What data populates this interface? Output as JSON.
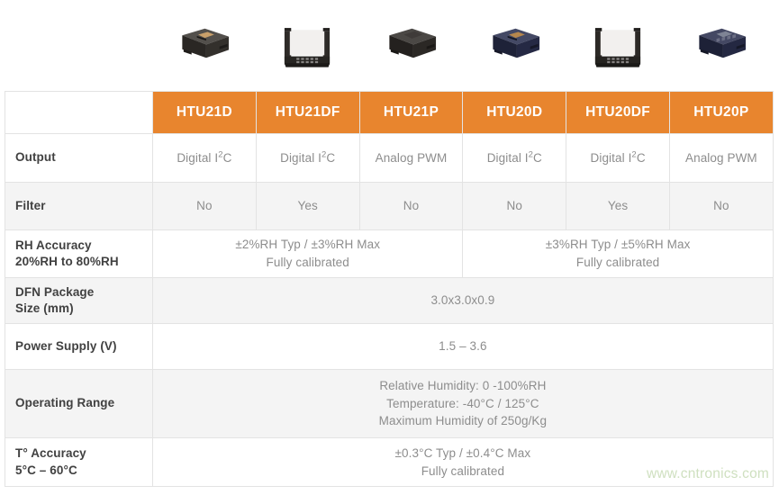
{
  "products": [
    {
      "name": "HTU21D",
      "icon": "chip-black-top-view",
      "body_color": "#3c3834",
      "pad_color": "#c9a06a",
      "style": "flat-black"
    },
    {
      "name": "HTU21DF",
      "icon": "chip-black-filter-cap",
      "body_color": "#2e2b28",
      "pad_color": "#ffffff",
      "style": "filter-cap-black"
    },
    {
      "name": "HTU21P",
      "icon": "chip-black-plain-top",
      "body_color": "#332f2c",
      "pad_color": "#2a2724",
      "style": "flat-black-plain"
    },
    {
      "name": "HTU20D",
      "icon": "chip-blue-top-view",
      "body_color": "#2b3050",
      "pad_color": "#b6874d",
      "style": "flat-blue"
    },
    {
      "name": "HTU20DF",
      "icon": "chip-black-filter-cap-2",
      "body_color": "#2c2926",
      "pad_color": "#ffffff",
      "style": "filter-cap-black"
    },
    {
      "name": "HTU20P",
      "icon": "chip-blue-plain-top",
      "body_color": "#2a2f4e",
      "pad_color": "#8a8f9e",
      "style": "flat-blue-plain"
    }
  ],
  "table": {
    "corner_label": "",
    "columns": [
      "HTU21D",
      "HTU21DF",
      "HTU21P",
      "HTU20D",
      "HTU20DF",
      "HTU20P"
    ],
    "rows": [
      {
        "label": "Output",
        "label_lines": [
          "Output"
        ],
        "shaded": false,
        "cells": [
          {
            "text": "Digital I2C",
            "base": "Digital I",
            "sup": "2",
            "tail": "C",
            "span": 1
          },
          {
            "text": "Digital I2C",
            "base": "Digital I",
            "sup": "2",
            "tail": "C",
            "span": 1
          },
          {
            "text": "Analog PWM",
            "base": "Analog PWM",
            "sup": "",
            "tail": "",
            "span": 1
          },
          {
            "text": "Digital I2C",
            "base": "Digital I",
            "sup": "2",
            "tail": "C",
            "span": 1
          },
          {
            "text": "Digital I2C",
            "base": "Digital I",
            "sup": "2",
            "tail": "C",
            "span": 1
          },
          {
            "text": "Analog PWM",
            "base": "Analog PWM",
            "sup": "",
            "tail": "",
            "span": 1
          }
        ]
      },
      {
        "label": "Filter",
        "label_lines": [
          "Filter"
        ],
        "shaded": true,
        "cells": [
          {
            "text": "No",
            "base": "No",
            "sup": "",
            "tail": "",
            "span": 1
          },
          {
            "text": "Yes",
            "base": "Yes",
            "sup": "",
            "tail": "",
            "span": 1
          },
          {
            "text": "No",
            "base": "No",
            "sup": "",
            "tail": "",
            "span": 1
          },
          {
            "text": "No",
            "base": "No",
            "sup": "",
            "tail": "",
            "span": 1
          },
          {
            "text": "Yes",
            "base": "Yes",
            "sup": "",
            "tail": "",
            "span": 1
          },
          {
            "text": "No",
            "base": "No",
            "sup": "",
            "tail": "",
            "span": 1
          }
        ]
      },
      {
        "label": "RH Accuracy 20%RH to 80%RH",
        "label_lines": [
          "RH Accuracy",
          "20%RH to 80%RH"
        ],
        "shaded": false,
        "cells": [
          {
            "text": "±2%RH Typ / ±3%RH Max Fully calibrated",
            "lines": [
              "±2%RH Typ / ±3%RH Max",
              "Fully calibrated"
            ],
            "span": 3
          },
          {
            "text": "±3%RH Typ / ±5%RH Max Fully calibrated",
            "lines": [
              "±3%RH Typ / ±5%RH Max",
              "Fully calibrated"
            ],
            "span": 3
          }
        ]
      },
      {
        "label": "DFN Package Size (mm)",
        "label_lines": [
          "DFN Package",
          "Size (mm)"
        ],
        "shaded": true,
        "cells": [
          {
            "text": "3.0x3.0x0.9",
            "lines": [
              "3.0x3.0x0.9"
            ],
            "span": 6
          }
        ]
      },
      {
        "label": "Power Supply (V)",
        "label_lines": [
          "Power Supply (V)"
        ],
        "shaded": false,
        "cells": [
          {
            "text": "1.5 – 3.6",
            "lines": [
              "1.5 – 3.6"
            ],
            "span": 6
          }
        ]
      },
      {
        "label": "Operating Range",
        "label_lines": [
          "Operating Range"
        ],
        "shaded": true,
        "cells": [
          {
            "text": "Relative Humidity: 0 -100%RH Temperature: -40°C / 125°C Maximum Humidity of 250g/Kg",
            "lines": [
              "Relative Humidity: 0 -100%RH",
              "Temperature: -40°C / 125°C",
              "Maximum Humidity of 250g/Kg"
            ],
            "span": 6
          }
        ]
      },
      {
        "label": "T° Accuracy 5°C – 60°C",
        "label_lines": [
          "T° Accuracy",
          "5°C – 60°C"
        ],
        "shaded": false,
        "cells": [
          {
            "text": "±0.3°C Typ / ±0.4°C Max Fully calibrated",
            "lines": [
              "±0.3°C Typ / ±0.4°C Max",
              "Fully calibrated"
            ],
            "span": 6
          }
        ]
      }
    ]
  },
  "watermark": {
    "text": "www.cntronics.com",
    "color": "#cfe0c0"
  },
  "colors": {
    "header_orange": "#e8852e",
    "header_divider": "#ef9a53",
    "shade_row": "#f4f4f4",
    "border": "#e3e3e3",
    "label_text": "#414141",
    "value_text": "#8d8d8d"
  }
}
